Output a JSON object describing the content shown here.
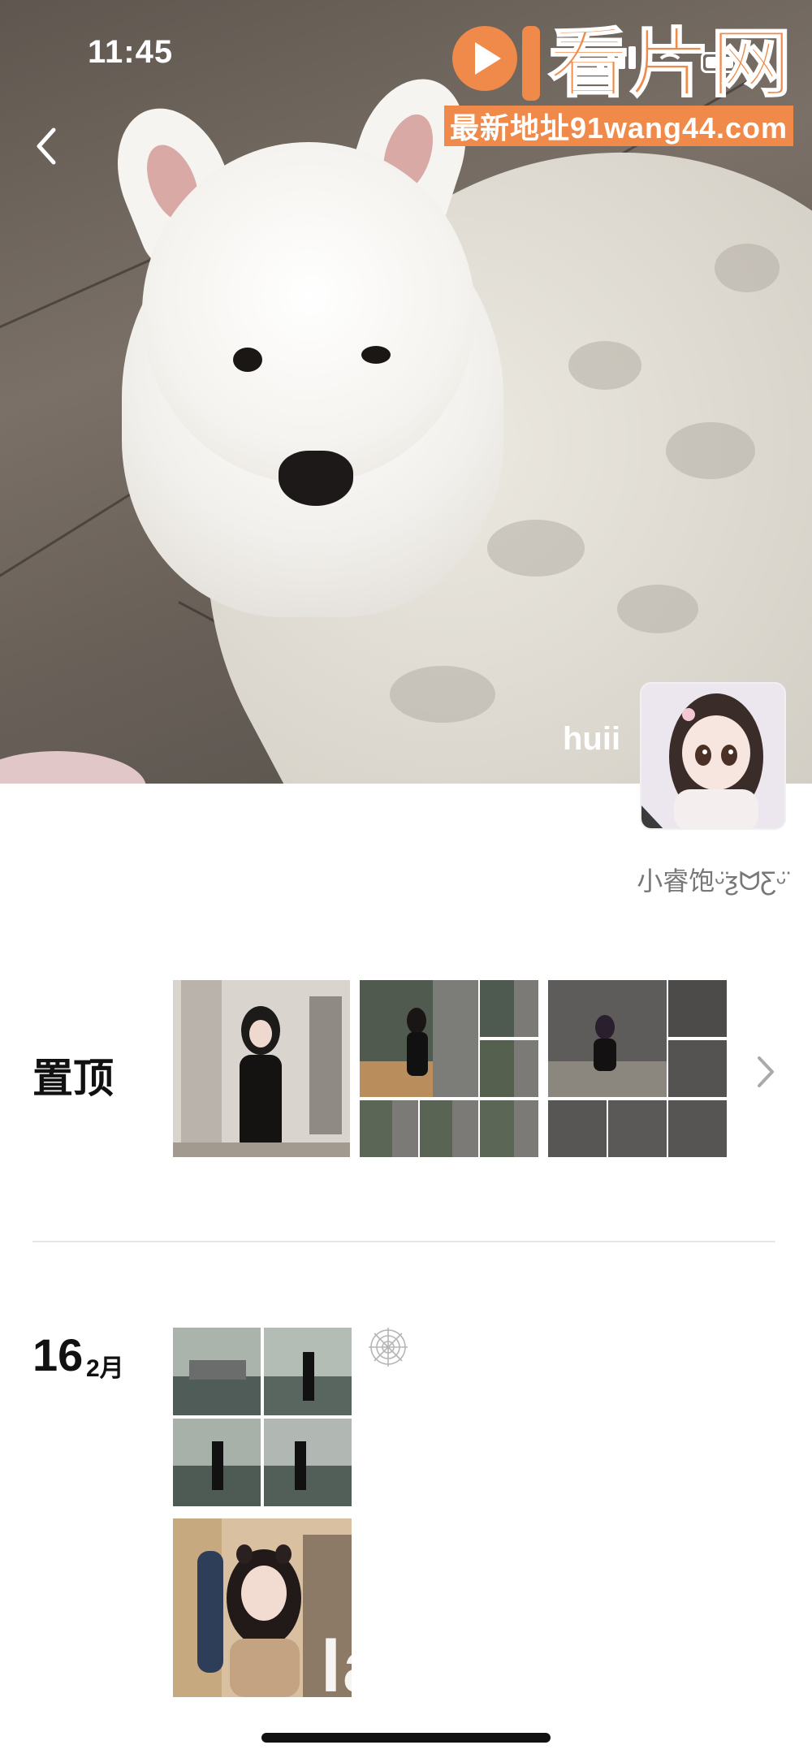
{
  "status_bar": {
    "time": "11:45",
    "icons": [
      "signal-icon",
      "wifi-icon",
      "battery-icon"
    ]
  },
  "watermark": {
    "logo_text": "91看片网",
    "url_text": "最新地址91wang44.com",
    "color": "#ef8a4a"
  },
  "cover": {
    "username_overlay": "huii"
  },
  "profile": {
    "signature": "小睿饱ᵕ̈ƺᗢƸᵕ̈"
  },
  "pinned": {
    "label": "置顶"
  },
  "posts": [
    {
      "day": "16",
      "month": "2月"
    }
  ],
  "overlay_text": "lanjin.cc",
  "colors": {
    "divider": "#e6e6e6",
    "text_primary": "#111111",
    "text_secondary": "#777777"
  }
}
